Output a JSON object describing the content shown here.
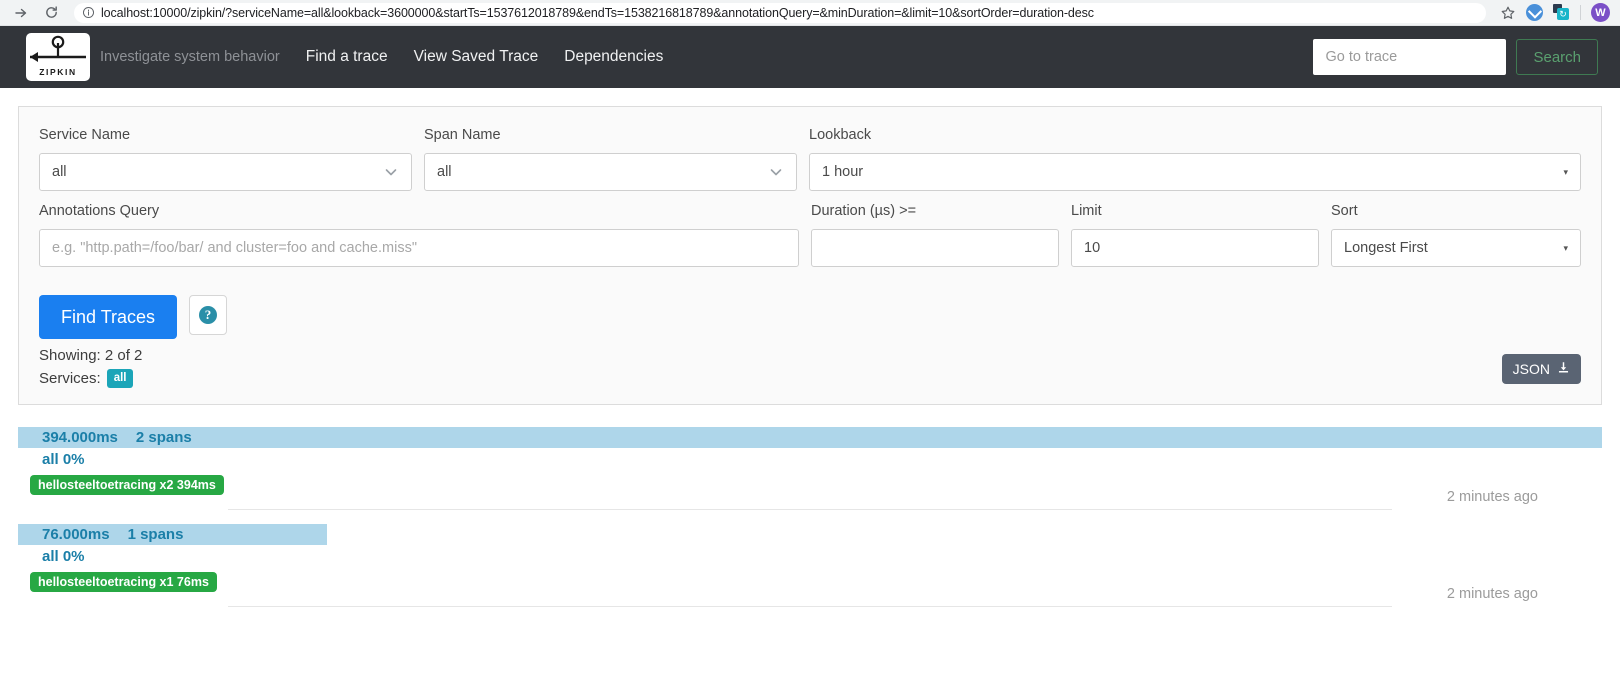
{
  "browser": {
    "url": "localhost:10000/zipkin/?serviceName=all&lookback=3600000&startTs=1537612018789&endTs=1538216818789&annotationQuery=&minDuration=&limit=10&sortOrder=duration-desc",
    "forward_icon": "forward-arrow-icon",
    "reload_icon": "reload-icon",
    "info_icon": "site-info-icon",
    "bookmark_icon": "star-icon",
    "extension_1_icon": "extension-icon",
    "extension_2_icon": "extension-icon",
    "profile_initial": "W"
  },
  "navbar": {
    "logo_text": "ZIPKIN",
    "tagline": "Investigate system behavior",
    "links": [
      {
        "label": "Find a trace"
      },
      {
        "label": "View Saved Trace"
      },
      {
        "label": "Dependencies"
      }
    ],
    "goto_trace_placeholder": "Go to trace",
    "goto_trace_value": "",
    "search_label": "Search"
  },
  "search_form": {
    "service_name": {
      "label": "Service Name",
      "value": "all"
    },
    "span_name": {
      "label": "Span Name",
      "value": "all"
    },
    "lookback": {
      "label": "Lookback",
      "value": "1 hour"
    },
    "annotations_query": {
      "label": "Annotations Query",
      "value": "",
      "placeholder": "e.g. \"http.path=/foo/bar/ and cluster=foo and cache.miss\""
    },
    "duration": {
      "label": "Duration (µs) >=",
      "value": "",
      "placeholder": ""
    },
    "limit": {
      "label": "Limit",
      "value": "10"
    },
    "sort": {
      "label": "Sort",
      "value": "Longest First"
    },
    "find_traces_label": "Find Traces",
    "help_icon": "question-mark-icon",
    "help_glyph": "?",
    "showing_text": "Showing: 2 of 2",
    "services_label": "Services:",
    "services_badge": "all",
    "json_label": "JSON",
    "json_icon": "download-icon"
  },
  "results": [
    {
      "duration": "394.000ms",
      "spans": "2 spans",
      "subtitle": "all 0%",
      "service_badge": "hellosteeltoetracing x2 394ms",
      "timestamp": "2 minutes ago",
      "bar_width_pct": 100
    },
    {
      "duration": "76.000ms",
      "spans": "1 spans",
      "subtitle": "all 0%",
      "service_badge": "hellosteeltoetracing x1 76ms",
      "timestamp": "2 minutes ago",
      "bar_width_pct": 19.5
    }
  ],
  "colors": {
    "navbar_bg": "#32353a",
    "primary_blue": "#1a7ff0",
    "trace_bar": "#aed6ea",
    "trace_text": "#1b7fa8",
    "service_green": "#27a844",
    "badge_teal": "#1ba5b8",
    "json_slate": "#5a6473",
    "search_green": "#5aa06f"
  }
}
